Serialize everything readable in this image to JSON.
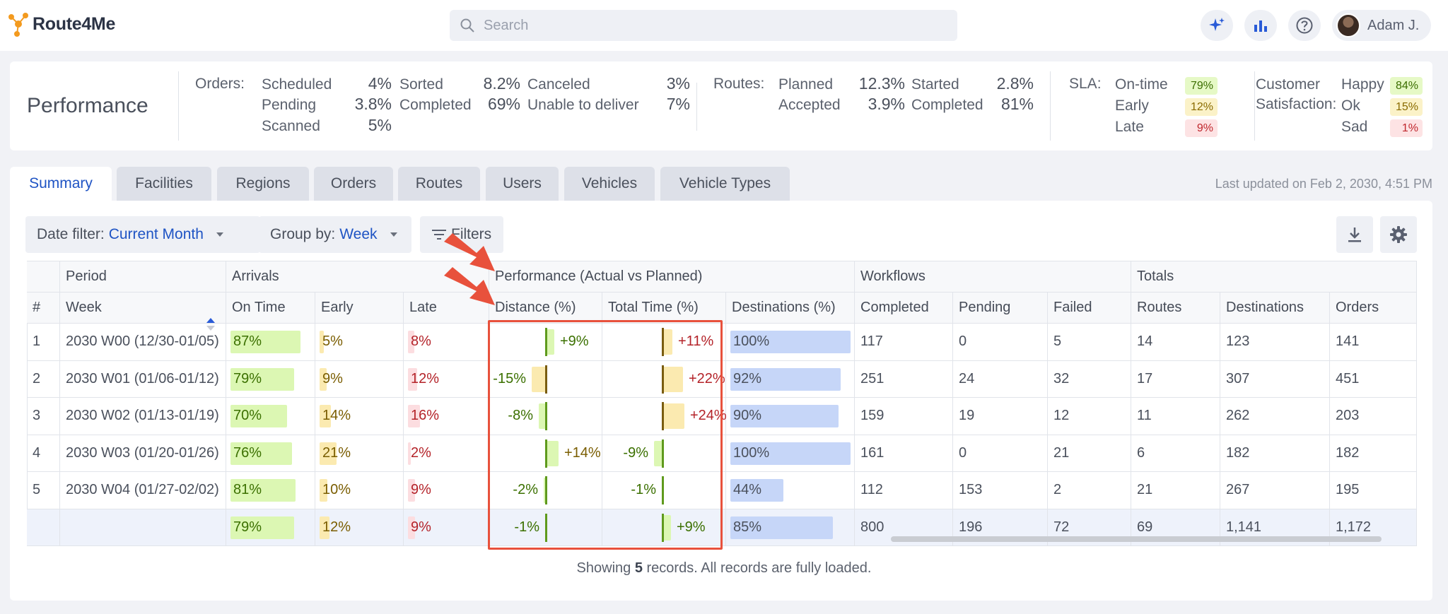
{
  "app": {
    "name": "Route4Me"
  },
  "header": {
    "search_placeholder": "Search",
    "icons": [
      "sparkle-icon",
      "bar-chart-icon",
      "help-icon"
    ],
    "user_name": "Adam J."
  },
  "kpi": {
    "title": "Performance",
    "orders_label": "Orders:",
    "orders": [
      {
        "label": "Scheduled",
        "value": "4%"
      },
      {
        "label": "Pending",
        "value": "3.8%"
      },
      {
        "label": "Scanned",
        "value": "5%"
      },
      {
        "label": "Sorted",
        "value": "8.2%"
      },
      {
        "label": "Completed",
        "value": "69%"
      },
      {
        "label": "Canceled",
        "value": "3%"
      },
      {
        "label": "Unable to deliver",
        "value": "7%"
      }
    ],
    "routes_label": "Routes:",
    "routes": [
      {
        "label": "Planned",
        "value": "12.3%"
      },
      {
        "label": "Accepted",
        "value": "3.9%"
      },
      {
        "label": "Started",
        "value": "2.8%"
      },
      {
        "label": "Completed",
        "value": "81%"
      }
    ],
    "sla_label": "SLA:",
    "sla": [
      {
        "label": "On-time",
        "value": "79%"
      },
      {
        "label": "Early",
        "value": "12%"
      },
      {
        "label": "Late",
        "value": "9%"
      }
    ],
    "cs_label_1": "Customer",
    "cs_label_2": "Satisfaction:",
    "cs": [
      {
        "label": "Happy",
        "value": "84%"
      },
      {
        "label": "Ok",
        "value": "15%"
      },
      {
        "label": "Sad",
        "value": "1%"
      }
    ]
  },
  "tabs": [
    "Summary",
    "Facilities",
    "Regions",
    "Orders",
    "Routes",
    "Users",
    "Vehicles",
    "Vehicle Types"
  ],
  "active_tab": "Summary",
  "last_updated": "Last updated on Feb 2, 2030, 4:51 PM",
  "toolbar": {
    "date_filter_label": "Date filter:",
    "date_filter_value": "Current Month",
    "group_by_label": "Group by:",
    "group_by_value": "Week",
    "filters_label": "Filters"
  },
  "table": {
    "group_headers": [
      "Period",
      "Arrivals",
      "Performance (Actual vs Planned)",
      "Workflows",
      "Totals"
    ],
    "columns": [
      "#",
      "Week",
      "On Time",
      "Early",
      "Late",
      "Distance (%)",
      "Total Time (%)",
      "Destinations (%)",
      "Completed",
      "Pending",
      "Failed",
      "Routes",
      "Destinations",
      "Orders"
    ],
    "rows": [
      {
        "num": "1",
        "week": "2030 W00 (12/30-01/05)",
        "on_time": "87%",
        "early": "5%",
        "late": "8%",
        "distance": "+9%",
        "total_time": "+11%",
        "destinations": "100%",
        "completed": "117",
        "pending": "0",
        "failed": "5",
        "routes": "14",
        "dests": "123",
        "orders": "141"
      },
      {
        "num": "2",
        "week": "2030 W01 (01/06-01/12)",
        "on_time": "79%",
        "early": "9%",
        "late": "12%",
        "distance": "-15%",
        "total_time": "+22%",
        "destinations": "92%",
        "completed": "251",
        "pending": "24",
        "failed": "32",
        "routes": "17",
        "dests": "307",
        "orders": "451"
      },
      {
        "num": "3",
        "week": "2030 W02 (01/13-01/19)",
        "on_time": "70%",
        "early": "14%",
        "late": "16%",
        "distance": "-8%",
        "total_time": "+24%",
        "destinations": "90%",
        "completed": "159",
        "pending": "19",
        "failed": "12",
        "routes": "11",
        "dests": "262",
        "orders": "203"
      },
      {
        "num": "4",
        "week": "2030 W03 (01/20-01/26)",
        "on_time": "76%",
        "early": "21%",
        "late": "2%",
        "distance": "+14%",
        "total_time": "-9%",
        "destinations": "100%",
        "completed": "161",
        "pending": "0",
        "failed": "21",
        "routes": "6",
        "dests": "182",
        "orders": "182"
      },
      {
        "num": "5",
        "week": "2030 W04 (01/27-02/02)",
        "on_time": "81%",
        "early": "10%",
        "late": "9%",
        "distance": "-2%",
        "total_time": "-1%",
        "destinations": "44%",
        "completed": "112",
        "pending": "153",
        "failed": "2",
        "routes": "21",
        "dests": "267",
        "orders": "195"
      }
    ],
    "totals": {
      "on_time": "79%",
      "early": "12%",
      "late": "9%",
      "distance": "-1%",
      "total_time": "+9%",
      "destinations": "85%",
      "completed": "800",
      "pending": "196",
      "failed": "72",
      "routes": "69",
      "dests": "1,141",
      "orders": "1,172"
    }
  },
  "footer": {
    "prefix": "Showing",
    "count": "5",
    "suffix": "records. All records are fully loaded."
  }
}
